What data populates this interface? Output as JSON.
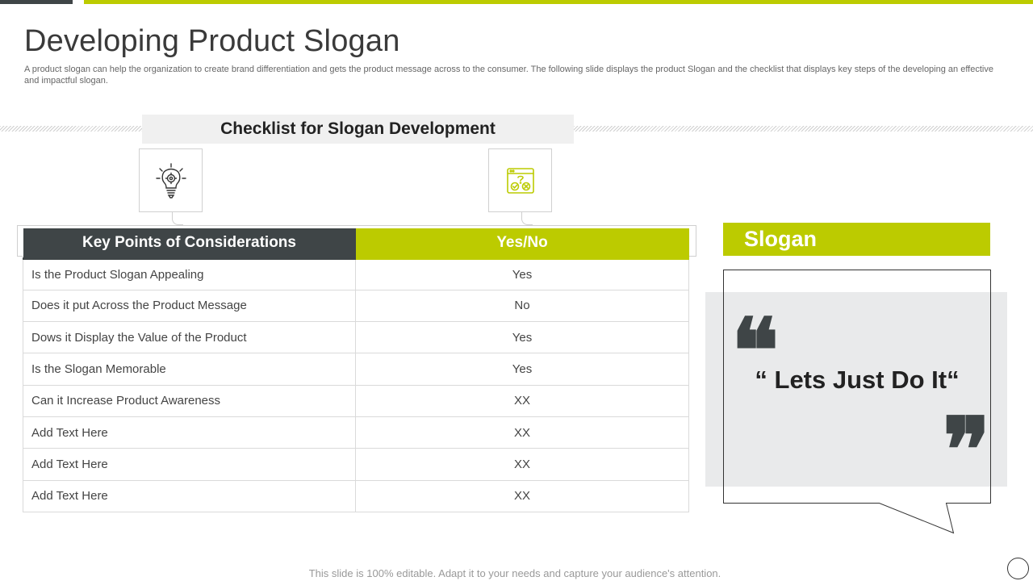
{
  "title": "Developing Product Slogan",
  "subtitle": "A product slogan can help the organization to create brand differentiation and gets the product message across to the consumer. The following slide displays the product Slogan and the checklist that displays key steps of the developing an effective  and impactful slogan.",
  "checklist": {
    "header": "Checklist for Slogan Development",
    "icons": [
      "lightbulb-gear-icon",
      "checklist-window-icon"
    ]
  },
  "table": {
    "headers": [
      "Key Points of Considerations",
      "Yes/No"
    ],
    "rows": [
      {
        "point": "Is the Product Slogan Appealing",
        "answer": "Yes"
      },
      {
        "point": "Does it put Across the Product Message",
        "answer": "No"
      },
      {
        "point": "Dows it Display the Value of the Product",
        "answer": "Yes"
      },
      {
        "point": "Is the Slogan Memorable",
        "answer": "Yes"
      },
      {
        "point": "Can it Increase Product Awareness",
        "answer": "XX"
      },
      {
        "point": "Add Text Here",
        "answer": "XX"
      },
      {
        "point": "Add Text Here",
        "answer": "XX"
      },
      {
        "point": "Add Text Here",
        "answer": "XX"
      }
    ]
  },
  "slogan": {
    "heading": "Slogan",
    "text": "“ Lets Just Do It“",
    "open_quote": "❝",
    "close_quote": "❞"
  },
  "footer": "This slide is 100% editable. Adapt it to your needs and capture your audience's attention.",
  "colors": {
    "accent": "#bccb00",
    "dark": "#3f4547"
  }
}
